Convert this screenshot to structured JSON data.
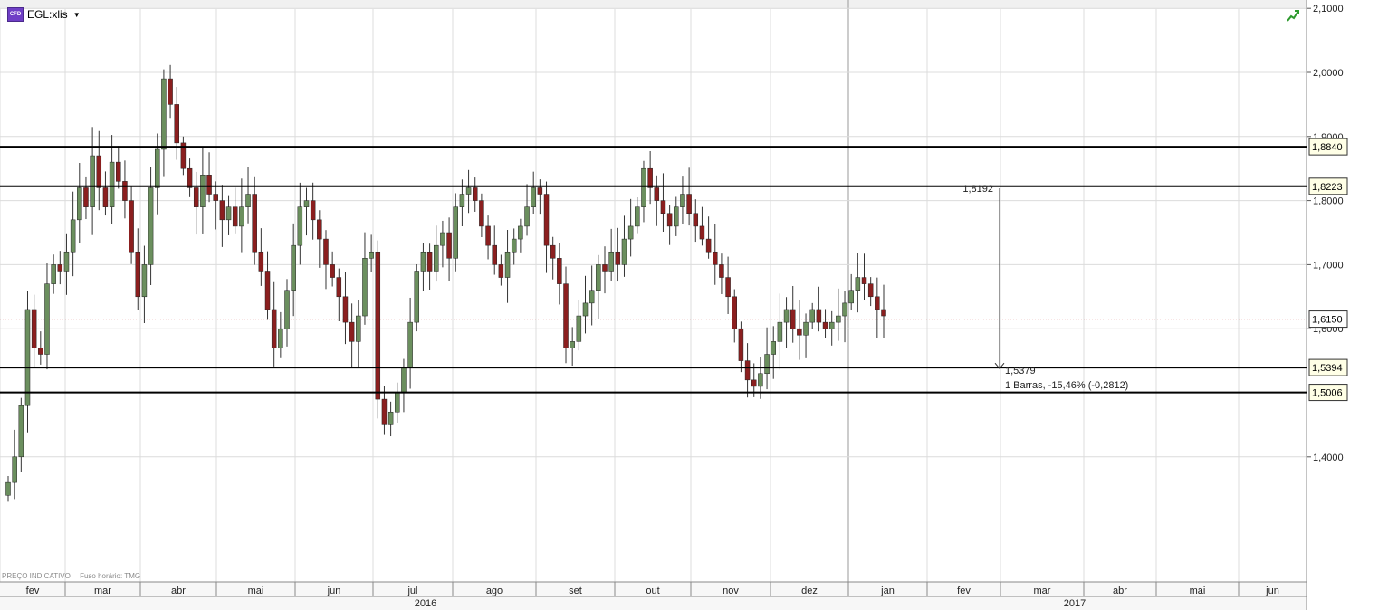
{
  "symbol": {
    "name": "EGL:xlis",
    "icon_text": "CFD",
    "icon": "cfd-badge-icon",
    "dropdown_icon": "caret-down-icon"
  },
  "toolbar": {
    "trend_icon": "trend-arrow-icon"
  },
  "footer": {
    "indicative": "PREÇO INDICATIVO",
    "timezone": "Fuso horário: TMG"
  },
  "colors": {
    "up": "#6b8f5e",
    "down": "#8b1f1f",
    "wick": "#333333",
    "grid": "#dcdcdc",
    "hline": "#000000",
    "current": "#cc3333",
    "axis_bg": "#f2f2f2"
  },
  "chart_data": {
    "type": "candlestick",
    "y_axis": {
      "min": 1.35,
      "max": 2.1,
      "ticks": [
        "2,1000",
        "2,0000",
        "1,9000",
        "1,8000",
        "1,7000",
        "1,6000",
        "1,4000"
      ]
    },
    "x_axis": {
      "months": [
        "fev",
        "mar",
        "abr",
        "mai",
        "jun",
        "jul",
        "ago",
        "set",
        "out",
        "nov",
        "dez",
        "jan",
        "fev",
        "mar",
        "abr",
        "mai",
        "jun"
      ],
      "years": [
        "2016",
        "2017"
      ]
    },
    "horizontal_lines": [
      {
        "value": 1.884,
        "label": "1,8840"
      },
      {
        "value": 1.8223,
        "label": "1,8223"
      },
      {
        "value": 1.5394,
        "label": "1,5394"
      },
      {
        "value": 1.5006,
        "label": "1,5006"
      }
    ],
    "current_price": {
      "value": 1.615,
      "label": "1,6150"
    },
    "measure": {
      "start_value": 1.8192,
      "start_label": "1,8192",
      "end_value": 1.5379,
      "end_label": "1,5379",
      "summary": "1 Barras, -15,46% (-0,2812)"
    },
    "candles_close": [
      1.36,
      1.4,
      1.48,
      1.63,
      1.57,
      1.56,
      1.67,
      1.7,
      1.69,
      1.72,
      1.77,
      1.82,
      1.79,
      1.87,
      1.82,
      1.79,
      1.86,
      1.83,
      1.8,
      1.72,
      1.65,
      1.7,
      1.82,
      1.88,
      1.99,
      1.95,
      1.89,
      1.85,
      1.82,
      1.79,
      1.84,
      1.81,
      1.8,
      1.77,
      1.79,
      1.76,
      1.79,
      1.81,
      1.72,
      1.69,
      1.63,
      1.57,
      1.6,
      1.66,
      1.73,
      1.79,
      1.8,
      1.77,
      1.74,
      1.7,
      1.68,
      1.65,
      1.61,
      1.58,
      1.62,
      1.71,
      1.72,
      1.49,
      1.45,
      1.47,
      1.5,
      1.54,
      1.61,
      1.69,
      1.72,
      1.69,
      1.73,
      1.75,
      1.71,
      1.79,
      1.81,
      1.82,
      1.8,
      1.76,
      1.73,
      1.7,
      1.68,
      1.72,
      1.74,
      1.76,
      1.79,
      1.82,
      1.81,
      1.73,
      1.71,
      1.67,
      1.57,
      1.58,
      1.62,
      1.64,
      1.66,
      1.7,
      1.69,
      1.72,
      1.7,
      1.74,
      1.76,
      1.79,
      1.85,
      1.82,
      1.8,
      1.78,
      1.76,
      1.79,
      1.81,
      1.78,
      1.76,
      1.74,
      1.72,
      1.7,
      1.68,
      1.65,
      1.6,
      1.55,
      1.52,
      1.51,
      1.53,
      1.56,
      1.58,
      1.61,
      1.63,
      1.6,
      1.59,
      1.61,
      1.63,
      1.61,
      1.6,
      1.61,
      1.62,
      1.64,
      1.66,
      1.68,
      1.67,
      1.65,
      1.63,
      1.62
    ]
  }
}
